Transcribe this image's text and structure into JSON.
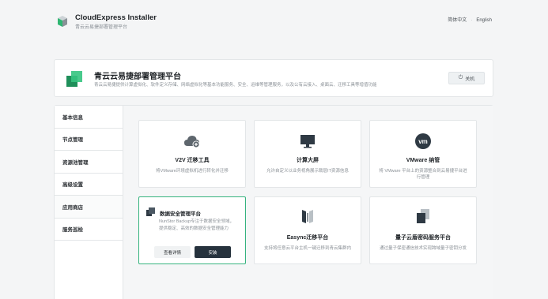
{
  "app": {
    "title": "CloudExpress Installer",
    "subtitle": "青云云易捷部署管理平台",
    "languages": [
      "简体中文",
      "English"
    ]
  },
  "hero": {
    "title": "青云云易捷部署管理平台",
    "description": "青云云易捷提供计算虚拟化、软件定义存储、网络虚拟化等基本功能服务、安全、运维等管理服务，以及公有云接入、桌面云、迁移工具等增值功能",
    "power_label": "关机"
  },
  "sidebar": {
    "items": [
      {
        "label": "基本信息"
      },
      {
        "label": "节点管理"
      },
      {
        "label": "资源池管理"
      },
      {
        "label": "高级设置"
      },
      {
        "label": "应用商店"
      },
      {
        "label": "服务巡检"
      }
    ]
  },
  "apps": [
    {
      "title": "V2V 迁移工具",
      "desc": "将VMware环境虚拟机进行转化并迁移",
      "icon": "cloud-plus-icon"
    },
    {
      "title": "计算大屏",
      "desc": "允许自定义以业务视角展示裁层IT资源信息",
      "icon": "monitor-icon"
    },
    {
      "title": "VMware 纳管",
      "desc": "将 VMware 平台上的资源整合到云易捷平台进行管理",
      "icon": "vmware-icon"
    },
    {
      "title": "数据安全管理平台",
      "desc": "NunStor Backup专注于数据安全领域，提供稳定、高效的数据安全管理能力",
      "icon": "data-security-icon",
      "detail_label": "查看详情",
      "install_label": "安装"
    },
    {
      "title": "Easync迁移平台",
      "desc": "支持将任意云平台主机一键迁移到青云集群内",
      "icon": "easync-icon"
    },
    {
      "title": "量子云盾密码服务平台",
      "desc": "通过量子保密通信技术实现跨域量子密钥分发",
      "icon": "quantum-shield-icon"
    }
  ],
  "colors": {
    "accent": "#35b37e",
    "dark_button": "#26323d",
    "logo_green": "#2fb672"
  }
}
